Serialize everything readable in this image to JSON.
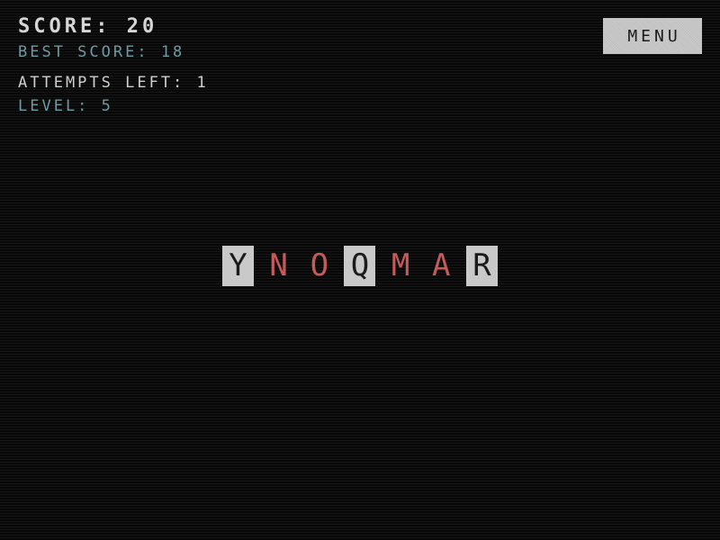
{
  "hud": {
    "score": "SCORE: 20",
    "best_score": "BEST SCORE: 18",
    "attempts_left": "ATTEMPTS LEFT: 1",
    "level": "LEVEL: 5"
  },
  "menu": {
    "label": "MENU"
  },
  "word": {
    "letters": [
      {
        "char": "Y",
        "state": "revealed"
      },
      {
        "char": "N",
        "state": "hidden"
      },
      {
        "char": "O",
        "state": "hidden"
      },
      {
        "char": "Q",
        "state": "revealed"
      },
      {
        "char": "M",
        "state": "hidden"
      },
      {
        "char": "A",
        "state": "hidden"
      },
      {
        "char": "R",
        "state": "revealed"
      }
    ]
  },
  "colors": {
    "background": "#0c0c0c",
    "hud_primary": "#d6d6d6",
    "hud_accent": "#6f9aa1",
    "tile_revealed_bg": "#c9c9c9",
    "tile_revealed_text": "#1a1a1a",
    "tile_hidden_text": "#c45a5a",
    "menu_bg": "#c8c8c8"
  }
}
